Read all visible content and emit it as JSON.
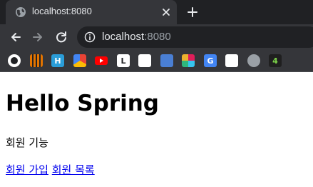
{
  "browser": {
    "tab": {
      "title": "localhost:8080",
      "favicon": "globe-icon",
      "close_icon": "close-icon"
    },
    "new_tab_icon": "plus-icon",
    "toolbar": {
      "back_icon": "back-arrow-icon",
      "forward_icon": "forward-arrow-icon",
      "reload_icon": "reload-icon",
      "site_info_icon": "info-icon",
      "url_host": "localhost",
      "url_port": ":8080"
    },
    "bookmarks": [
      {
        "name": "bookmark-1",
        "icon": "black-circle-icon",
        "glyph": "",
        "color": "#ffffff"
      },
      {
        "name": "bookmark-2",
        "icon": "striped-shield-icon",
        "glyph": "",
        "color": "#e37400"
      },
      {
        "name": "bookmark-3",
        "icon": "hi-logo-icon",
        "glyph": "H",
        "color": "#2a9dd8"
      },
      {
        "name": "bookmark-4",
        "icon": "colorful-app-icon",
        "glyph": "",
        "color": "#ffffff"
      },
      {
        "name": "bookmark-5",
        "icon": "youtube-icon",
        "glyph": "",
        "color": "#ff0000"
      },
      {
        "name": "bookmark-6",
        "icon": "letter-l-icon",
        "glyph": "L",
        "color": "#ffffff"
      },
      {
        "name": "bookmark-7",
        "icon": "mascot-icon",
        "glyph": "",
        "color": "#ffffff"
      },
      {
        "name": "bookmark-8",
        "icon": "blue-square-icon",
        "glyph": "",
        "color": "#4a7fd4"
      },
      {
        "name": "bookmark-9",
        "icon": "slack-icon",
        "glyph": "",
        "color": "#e01e5a"
      },
      {
        "name": "bookmark-10",
        "icon": "translate-icon",
        "glyph": "G",
        "color": "#4285f4"
      },
      {
        "name": "bookmark-11",
        "icon": "tree-dots-icon",
        "glyph": "",
        "color": "#ffffff"
      },
      {
        "name": "bookmark-12",
        "icon": "globe-icon",
        "glyph": "",
        "color": "#9aa0a6"
      },
      {
        "name": "bookmark-13",
        "icon": "number-4-icon",
        "glyph": "4",
        "color": "#1f1f1f"
      }
    ]
  },
  "page": {
    "title": "Hello Spring",
    "subtitle": "회원 기능",
    "links": [
      {
        "label": "회원 가입"
      },
      {
        "label": "회원 목록"
      }
    ]
  }
}
